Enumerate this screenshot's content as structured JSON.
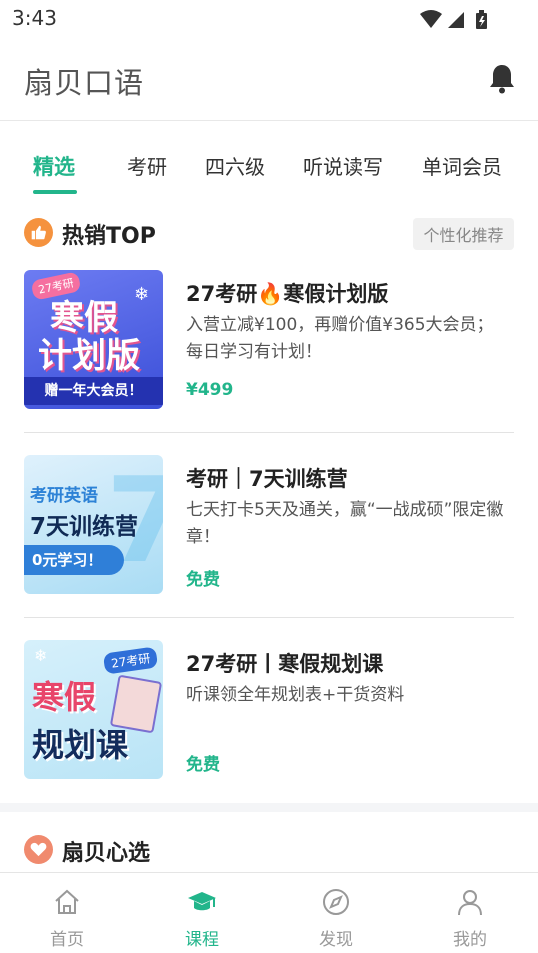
{
  "status_bar": {
    "time": "3:43"
  },
  "header": {
    "title": "扇贝口语"
  },
  "tabs": [
    "精选",
    "考研",
    "四六级",
    "听说读写",
    "单词会员"
  ],
  "hot_section": {
    "title": "热销TOP",
    "tag": "个性化推荐"
  },
  "courses": [
    {
      "title": "27考研🔥寒假计划版",
      "desc": "入营立减¥100，再赠价值¥365大会员； 每日学习有计划！",
      "price": "¥499",
      "thumb": {
        "badge": "27考研",
        "line1": "寒假",
        "line2": "计划版",
        "footer": "赠一年大会员！"
      }
    },
    {
      "title": "考研｜7天训练营",
      "desc": "七天打卡5天及通关，赢“一战成硕”限定徽章！",
      "price": "免费",
      "thumb": {
        "line1": "考研英语",
        "line2": "7天训练营",
        "footer": "0元学习！"
      }
    },
    {
      "title": "27考研丨寒假规划课",
      "desc": "听课领全年规划表+干货资料",
      "price": "免费",
      "thumb": {
        "badge": "27考研",
        "line1": "寒假",
        "line2": "规划课"
      }
    }
  ],
  "picks_section": {
    "title": "扇贝心选"
  },
  "bottom_nav": [
    {
      "label": "首页",
      "icon": "home-icon"
    },
    {
      "label": "课程",
      "icon": "graduation-cap-icon"
    },
    {
      "label": "发现",
      "icon": "compass-icon"
    },
    {
      "label": "我的",
      "icon": "person-icon"
    }
  ],
  "colors": {
    "accent": "#22b58b",
    "hot_icon": "#f5923e",
    "picks_icon": "#f08a6e"
  }
}
